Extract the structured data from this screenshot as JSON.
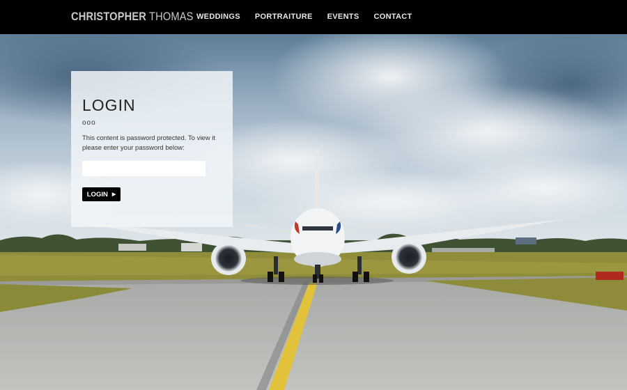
{
  "site": {
    "brand_bold": "CHRISTOPHER",
    "brand_light": "THOMAS"
  },
  "nav": {
    "items": [
      {
        "label": "WEDDINGS"
      },
      {
        "label": "PORTRAITURE"
      },
      {
        "label": "EVENTS"
      },
      {
        "label": "CONTACT"
      }
    ]
  },
  "login": {
    "title": "LOGIN",
    "dots": "ooo",
    "description": "This content is password protected. To view it please enter your password below:",
    "password_value": "",
    "button_label": "LOGIN",
    "button_icon": "play-arrow-icon"
  },
  "colors": {
    "navbar_bg": "#000000",
    "card_bg": "#f0f4f8",
    "button_bg": "#000000"
  }
}
